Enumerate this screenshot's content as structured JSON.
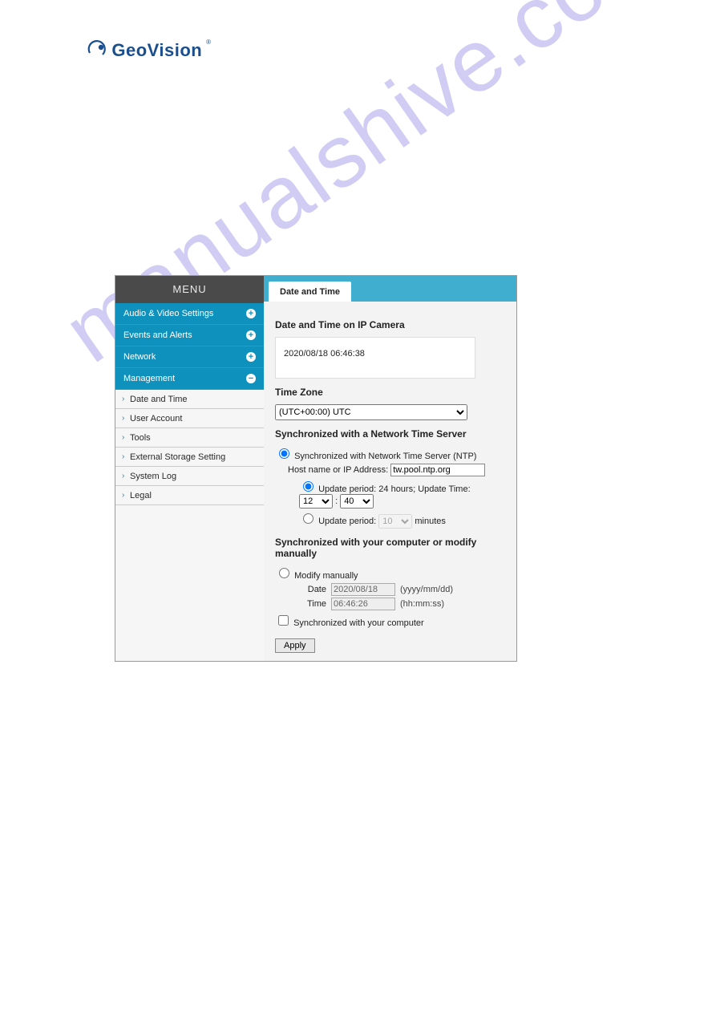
{
  "logo": {
    "text": "GeoVision"
  },
  "watermark": "manualshive.com",
  "sidebar": {
    "title": "MENU",
    "items": [
      {
        "label": "Audio & Video Settings",
        "icon": "plus"
      },
      {
        "label": "Events and Alerts",
        "icon": "plus"
      },
      {
        "label": "Network",
        "icon": "plus"
      },
      {
        "label": "Management",
        "icon": "minus"
      }
    ],
    "submenu": [
      {
        "label": "Date and Time"
      },
      {
        "label": "User Account"
      },
      {
        "label": "Tools"
      },
      {
        "label": "External Storage Setting"
      },
      {
        "label": "System Log"
      },
      {
        "label": "Legal"
      }
    ]
  },
  "tab": {
    "label": "Date and Time"
  },
  "panel": {
    "h_camera": "Date and Time on IP Camera",
    "current_time": "2020/08/18 06:46:38",
    "h_tz": "Time Zone",
    "tz_value": "(UTC+00:00) UTC",
    "h_ntp": "Synchronized with a Network Time Server",
    "ntp_radio_label": "Synchronized with Network Time Server (NTP)",
    "host_label": "Host name or IP Address:",
    "host_value": "tw.pool.ntp.org",
    "update24_label_a": "Update period: 24 hours; Update Time:",
    "update_hour": "12",
    "update_colon": ":",
    "update_min": "40",
    "update_any_label_a": "Update period:",
    "update_any_val": "10",
    "update_any_label_b": "minutes",
    "h_manual": "Synchronized with your computer or modify manually",
    "manual_radio_label": "Modify manually",
    "date_label": "Date",
    "date_value": "2020/08/18",
    "date_hint": "(yyyy/mm/dd)",
    "time_label": "Time",
    "time_value": "06:46:26",
    "time_hint": "(hh:mm:ss)",
    "sync_pc_label": "Synchronized with your computer",
    "apply_label": "Apply"
  }
}
